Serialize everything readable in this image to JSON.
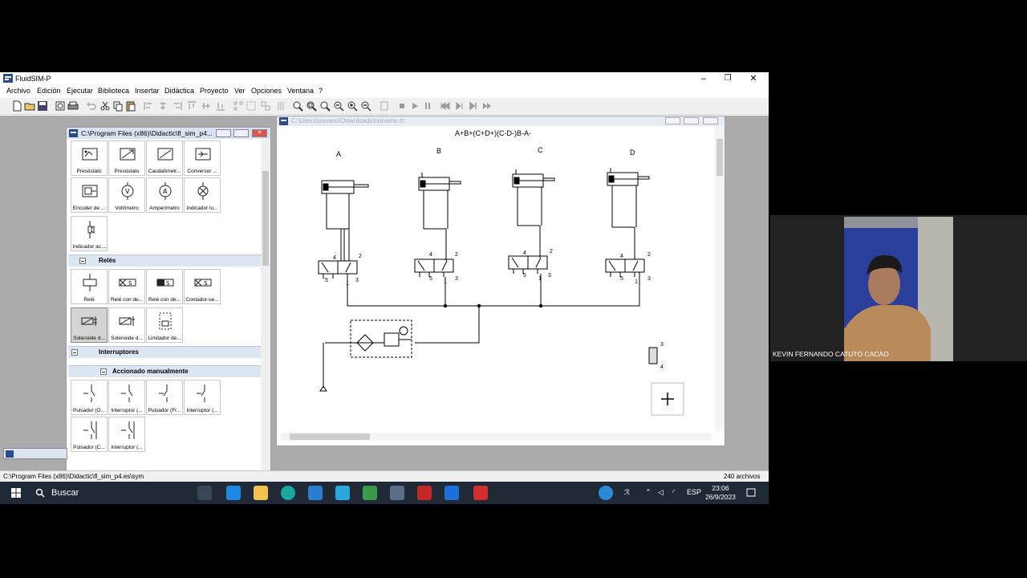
{
  "app": {
    "title": "FluidSIM-P",
    "menu": [
      "Archivo",
      "Edición",
      "Ejecutar",
      "Biblioteca",
      "Insertar",
      "Didáctica",
      "Proyecto",
      "Ver",
      "Opciones",
      "Ventana",
      "?"
    ],
    "window_controls": {
      "minimize": "–",
      "maximize": "❐",
      "close": "✕"
    }
  },
  "library_window": {
    "title": "C:\\Program Files (x86)\\Didactic\\fl_sim_p4...",
    "top_items": [
      "Presóstato",
      "Presóstato",
      "Caudalímetr...",
      "Conversor ...",
      "Encoder de ...",
      "Voltímetro",
      "Amperímetro",
      "Indicador lu...",
      "Indicador ac..."
    ],
    "category_reles": "Relés",
    "reles_items": [
      "Relé",
      "Relé con de...",
      "Relé con de...",
      "Contador-se...",
      "Solenoide d...",
      "Solenoide d...",
      "Limitador de..."
    ],
    "category_interruptores": "Interruptores",
    "subcategory_manual": "Accionado manualmente",
    "manual_items": [
      "Pulsador (O...",
      "Interruptor (...",
      "Pulsador (Fr...",
      "Interruptor (...",
      "Pulsador (C...",
      "Interruptor (..."
    ]
  },
  "circuit_window": {
    "title": "C:\\Users\\usuario\\Downloads\\noname.ct",
    "sequence": "A+B+(C+D+)(C-D-)B-A-",
    "cylinder_labels": [
      "A",
      "B",
      "C",
      "D"
    ],
    "port_labels": {
      "p4": "4",
      "p2": "2",
      "p5": "5",
      "p1": "1",
      "p3": "3"
    },
    "valve_port_top": "3",
    "valve_port_bottom": "4"
  },
  "statusbar": {
    "path": "C:\\Program Files (x86)\\Didactic\\fl_sim_p4.es\\sym",
    "count": "240 archivos"
  },
  "taskbar": {
    "search_placeholder": "Buscar",
    "language": "ESP",
    "time": "23:06",
    "date": "26/9/2023"
  },
  "video": {
    "participant_name": "KEVIN FERNANDO CATUTO CACAO"
  },
  "colors": {
    "taskbar": "#1f2a36",
    "category_header": "#dde6f3",
    "selected_item": "#d4d4d4"
  }
}
